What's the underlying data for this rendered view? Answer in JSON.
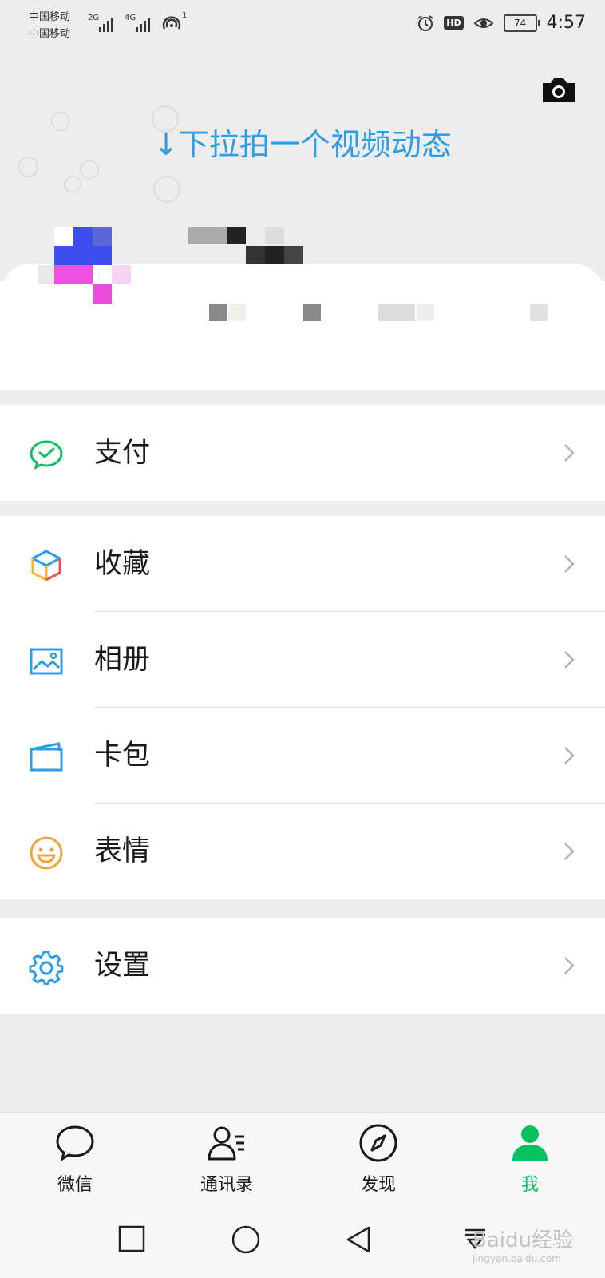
{
  "status_bar": {
    "carrier_1": "中国移动",
    "carrier_2": "中国移动",
    "net_1": "2G",
    "net_2": "4G",
    "hotspot_badge": "1",
    "hd_badge": "HD",
    "battery": "74",
    "time": "4:57"
  },
  "header": {
    "pull_hint": "↓下拉拍一个视频动态"
  },
  "menu": {
    "pay": {
      "label": "支付",
      "icon": "wechat-pay-icon"
    },
    "favorites": {
      "label": "收藏",
      "icon": "cube-icon"
    },
    "album": {
      "label": "相册",
      "icon": "image-icon"
    },
    "cards": {
      "label": "卡包",
      "icon": "card-icon"
    },
    "stickers": {
      "label": "表情",
      "icon": "smiley-icon"
    },
    "settings": {
      "label": "设置",
      "icon": "gear-icon"
    }
  },
  "tabs": [
    {
      "label": "微信",
      "icon": "chat-bubble-icon",
      "active": false
    },
    {
      "label": "通讯录",
      "icon": "contacts-icon",
      "active": false
    },
    {
      "label": "发现",
      "icon": "compass-icon",
      "active": false
    },
    {
      "label": "我",
      "icon": "person-icon",
      "active": true
    }
  ],
  "watermark": {
    "text": "Baidu经验",
    "url": "jingyan.baidu.com"
  },
  "colors": {
    "accent": "#07c160",
    "hint_blue": "#2e9de6",
    "background": "#ededed"
  }
}
